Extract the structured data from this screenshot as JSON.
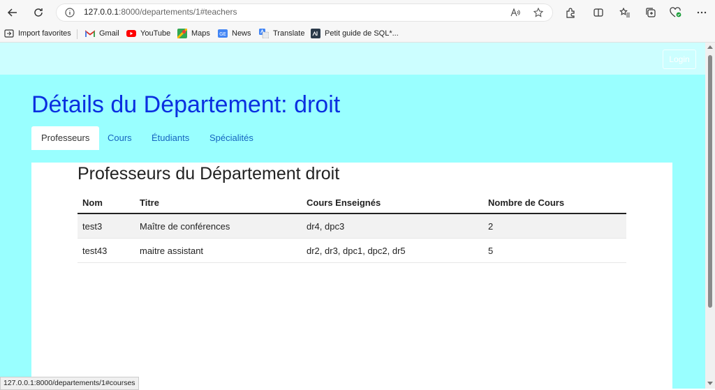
{
  "browser": {
    "url_host": "127.0.0.1",
    "url_rest": ":8000/departements/1#teachers",
    "bookmarks": [
      {
        "label": "Import favorites",
        "icon": "import-icon"
      },
      {
        "label": "Gmail",
        "icon": "gmail-icon"
      },
      {
        "label": "YouTube",
        "icon": "youtube-icon"
      },
      {
        "label": "Maps",
        "icon": "maps-icon"
      },
      {
        "label": "News",
        "icon": "news-icon"
      },
      {
        "label": "Translate",
        "icon": "translate-icon"
      },
      {
        "label": "Petit guide de SQL*...",
        "icon": "sql-guide-icon"
      }
    ],
    "status_url": "127.0.0.1:8000/departements/1#courses"
  },
  "nav": {
    "login_label": "Login"
  },
  "page": {
    "title": "Détails du Département: droit",
    "tabs": [
      "Professeurs",
      "Cours",
      "Étudiants",
      "Spécialités"
    ],
    "active_tab": "Professeurs"
  },
  "teachers": {
    "title": "Professeurs du Département droit",
    "columns": [
      "Nom",
      "Titre",
      "Cours Enseignés",
      "Nombre de Cours"
    ],
    "rows": [
      [
        "test3",
        "Maître de conférences",
        "dr4, dpc3",
        "2"
      ],
      [
        "test43",
        "maitre assistant",
        "dr2, dr3, dpc1, dpc2, dr5",
        "5"
      ]
    ]
  },
  "colors": {
    "page_bg": "#99ffff",
    "navbar_bg": "#ccfeff",
    "title_color": "#0a2fe0",
    "tab_link_color": "#1565c0"
  }
}
